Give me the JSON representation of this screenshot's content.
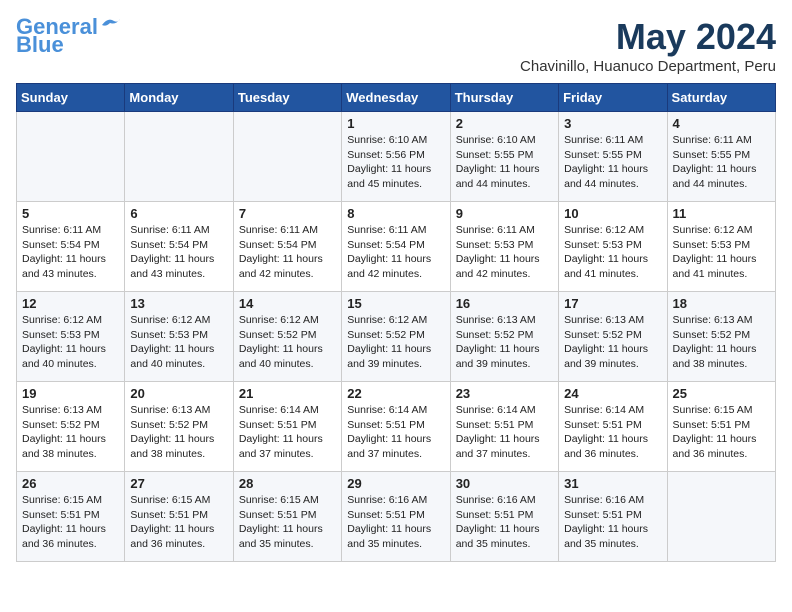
{
  "header": {
    "logo_line1": "General",
    "logo_line2": "Blue",
    "month_year": "May 2024",
    "location": "Chavinillo, Huanuco Department, Peru"
  },
  "weekdays": [
    "Sunday",
    "Monday",
    "Tuesday",
    "Wednesday",
    "Thursday",
    "Friday",
    "Saturday"
  ],
  "weeks": [
    [
      {
        "day": "",
        "text": ""
      },
      {
        "day": "",
        "text": ""
      },
      {
        "day": "",
        "text": ""
      },
      {
        "day": "1",
        "text": "Sunrise: 6:10 AM\nSunset: 5:56 PM\nDaylight: 11 hours and 45 minutes."
      },
      {
        "day": "2",
        "text": "Sunrise: 6:10 AM\nSunset: 5:55 PM\nDaylight: 11 hours and 44 minutes."
      },
      {
        "day": "3",
        "text": "Sunrise: 6:11 AM\nSunset: 5:55 PM\nDaylight: 11 hours and 44 minutes."
      },
      {
        "day": "4",
        "text": "Sunrise: 6:11 AM\nSunset: 5:55 PM\nDaylight: 11 hours and 44 minutes."
      }
    ],
    [
      {
        "day": "5",
        "text": "Sunrise: 6:11 AM\nSunset: 5:54 PM\nDaylight: 11 hours and 43 minutes."
      },
      {
        "day": "6",
        "text": "Sunrise: 6:11 AM\nSunset: 5:54 PM\nDaylight: 11 hours and 43 minutes."
      },
      {
        "day": "7",
        "text": "Sunrise: 6:11 AM\nSunset: 5:54 PM\nDaylight: 11 hours and 42 minutes."
      },
      {
        "day": "8",
        "text": "Sunrise: 6:11 AM\nSunset: 5:54 PM\nDaylight: 11 hours and 42 minutes."
      },
      {
        "day": "9",
        "text": "Sunrise: 6:11 AM\nSunset: 5:53 PM\nDaylight: 11 hours and 42 minutes."
      },
      {
        "day": "10",
        "text": "Sunrise: 6:12 AM\nSunset: 5:53 PM\nDaylight: 11 hours and 41 minutes."
      },
      {
        "day": "11",
        "text": "Sunrise: 6:12 AM\nSunset: 5:53 PM\nDaylight: 11 hours and 41 minutes."
      }
    ],
    [
      {
        "day": "12",
        "text": "Sunrise: 6:12 AM\nSunset: 5:53 PM\nDaylight: 11 hours and 40 minutes."
      },
      {
        "day": "13",
        "text": "Sunrise: 6:12 AM\nSunset: 5:53 PM\nDaylight: 11 hours and 40 minutes."
      },
      {
        "day": "14",
        "text": "Sunrise: 6:12 AM\nSunset: 5:52 PM\nDaylight: 11 hours and 40 minutes."
      },
      {
        "day": "15",
        "text": "Sunrise: 6:12 AM\nSunset: 5:52 PM\nDaylight: 11 hours and 39 minutes."
      },
      {
        "day": "16",
        "text": "Sunrise: 6:13 AM\nSunset: 5:52 PM\nDaylight: 11 hours and 39 minutes."
      },
      {
        "day": "17",
        "text": "Sunrise: 6:13 AM\nSunset: 5:52 PM\nDaylight: 11 hours and 39 minutes."
      },
      {
        "day": "18",
        "text": "Sunrise: 6:13 AM\nSunset: 5:52 PM\nDaylight: 11 hours and 38 minutes."
      }
    ],
    [
      {
        "day": "19",
        "text": "Sunrise: 6:13 AM\nSunset: 5:52 PM\nDaylight: 11 hours and 38 minutes."
      },
      {
        "day": "20",
        "text": "Sunrise: 6:13 AM\nSunset: 5:52 PM\nDaylight: 11 hours and 38 minutes."
      },
      {
        "day": "21",
        "text": "Sunrise: 6:14 AM\nSunset: 5:51 PM\nDaylight: 11 hours and 37 minutes."
      },
      {
        "day": "22",
        "text": "Sunrise: 6:14 AM\nSunset: 5:51 PM\nDaylight: 11 hours and 37 minutes."
      },
      {
        "day": "23",
        "text": "Sunrise: 6:14 AM\nSunset: 5:51 PM\nDaylight: 11 hours and 37 minutes."
      },
      {
        "day": "24",
        "text": "Sunrise: 6:14 AM\nSunset: 5:51 PM\nDaylight: 11 hours and 36 minutes."
      },
      {
        "day": "25",
        "text": "Sunrise: 6:15 AM\nSunset: 5:51 PM\nDaylight: 11 hours and 36 minutes."
      }
    ],
    [
      {
        "day": "26",
        "text": "Sunrise: 6:15 AM\nSunset: 5:51 PM\nDaylight: 11 hours and 36 minutes."
      },
      {
        "day": "27",
        "text": "Sunrise: 6:15 AM\nSunset: 5:51 PM\nDaylight: 11 hours and 36 minutes."
      },
      {
        "day": "28",
        "text": "Sunrise: 6:15 AM\nSunset: 5:51 PM\nDaylight: 11 hours and 35 minutes."
      },
      {
        "day": "29",
        "text": "Sunrise: 6:16 AM\nSunset: 5:51 PM\nDaylight: 11 hours and 35 minutes."
      },
      {
        "day": "30",
        "text": "Sunrise: 6:16 AM\nSunset: 5:51 PM\nDaylight: 11 hours and 35 minutes."
      },
      {
        "day": "31",
        "text": "Sunrise: 6:16 AM\nSunset: 5:51 PM\nDaylight: 11 hours and 35 minutes."
      },
      {
        "day": "",
        "text": ""
      }
    ]
  ]
}
